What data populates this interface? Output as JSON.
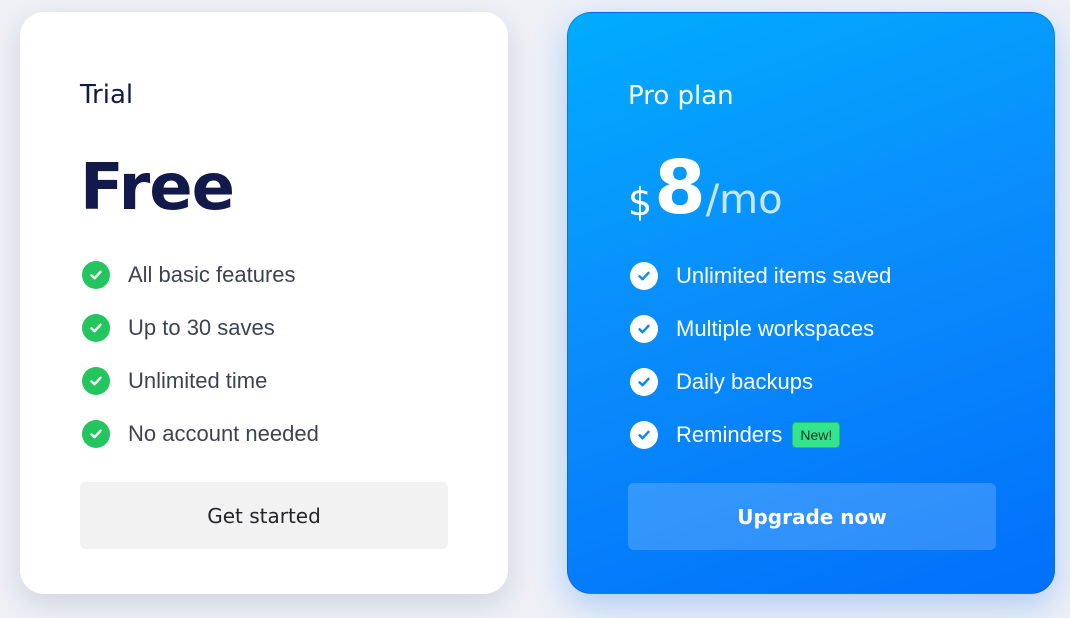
{
  "trial": {
    "name": "Trial",
    "price": "Free",
    "features": [
      "All basic features",
      "Up to 30 saves",
      "Unlimited time",
      "No account needed"
    ],
    "cta_label": "Get started"
  },
  "pro": {
    "name": "Pro plan",
    "currency": "$",
    "amount": "8",
    "period": "/mo",
    "features": [
      "Unlimited items saved",
      "Multiple workspaces",
      "Daily backups",
      "Reminders"
    ],
    "reminders_badge": "New!",
    "cta_label": "Upgrade now"
  },
  "colors": {
    "check_green": "#22c55e",
    "pro_gradient_start": "#00acfe",
    "pro_gradient_end": "#0170fb",
    "badge_green": "#34e48e",
    "heading_navy": "#111a4a"
  },
  "icons": {
    "feature_check": "check-circle-icon"
  }
}
